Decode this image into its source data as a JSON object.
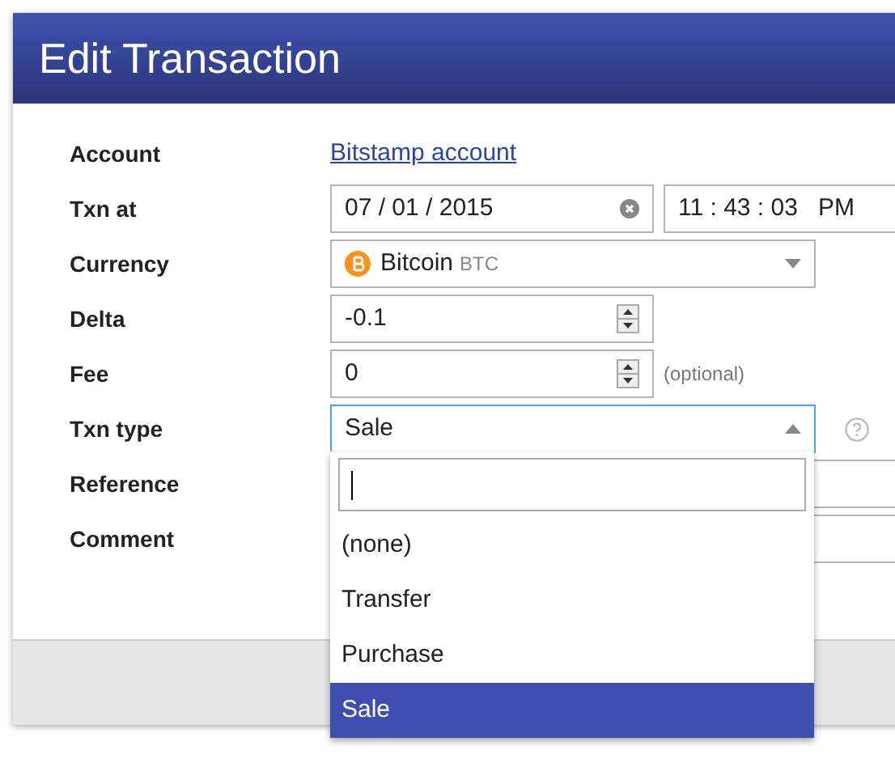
{
  "dialog": {
    "title": "Edit Transaction"
  },
  "fields": [
    {
      "label": "Account",
      "kind": "link",
      "value": "Bitstamp account"
    },
    {
      "label": "Txn at",
      "kind": "datetime",
      "date": "07 / 01 / 2015",
      "time": "11 : 43 : 03   PM"
    },
    {
      "label": "Currency",
      "kind": "currency",
      "value": "Bitcoin",
      "code": "BTC"
    },
    {
      "label": "Delta",
      "kind": "number",
      "value": "-0.1"
    },
    {
      "label": "Fee",
      "kind": "number",
      "value": "0",
      "hint": "(optional)"
    },
    {
      "label": "Txn type",
      "kind": "select",
      "value": "Sale",
      "expanded": true,
      "options": [
        {
          "label": "(none)",
          "selected": false
        },
        {
          "label": "Transfer",
          "selected": false
        },
        {
          "label": "Purchase",
          "selected": false
        },
        {
          "label": "Sale",
          "selected": true
        }
      ]
    },
    {
      "label": "Reference",
      "kind": "text"
    },
    {
      "label": "Comment",
      "kind": "text"
    }
  ]
}
